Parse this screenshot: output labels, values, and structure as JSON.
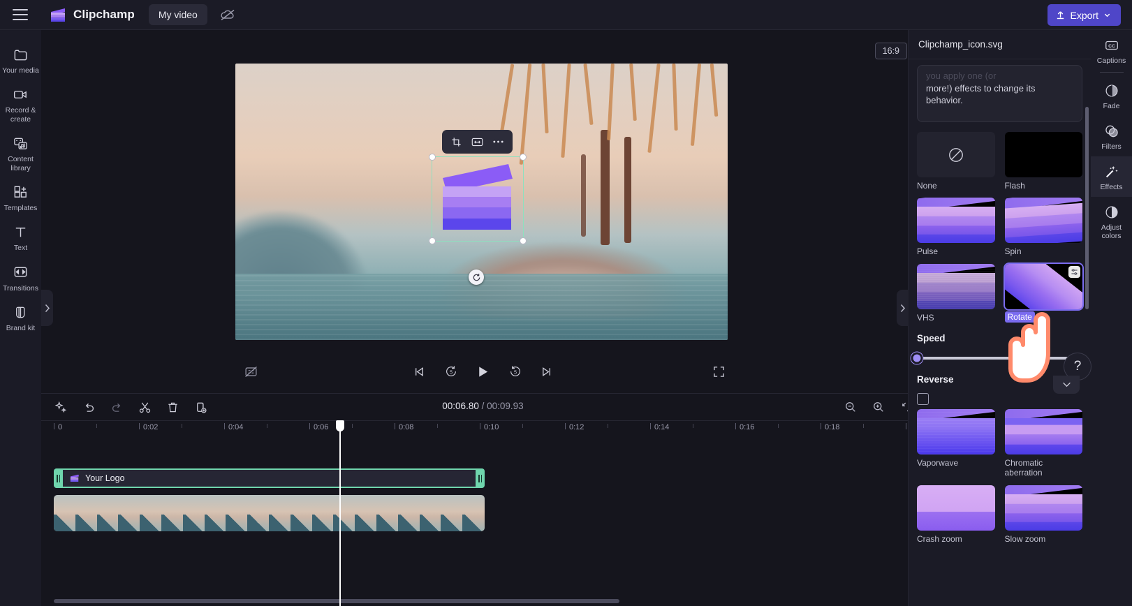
{
  "app": {
    "brand_name": "Clipchamp",
    "project_title": "My video",
    "export_label": "Export",
    "menu_icon": "hamburger-icon",
    "cloud_icon": "cloud-off-icon",
    "export_icon": "upload-icon"
  },
  "left_rail": {
    "items": [
      {
        "label": "Your media",
        "icon": "folder-icon"
      },
      {
        "label": "Record & create",
        "icon": "camera-icon"
      },
      {
        "label": "Content library",
        "icon": "library-icon"
      },
      {
        "label": "Templates",
        "icon": "templates-icon"
      },
      {
        "label": "Text",
        "icon": "text-icon"
      },
      {
        "label": "Transitions",
        "icon": "transitions-icon"
      },
      {
        "label": "Brand kit",
        "icon": "brandkit-icon"
      }
    ]
  },
  "stage": {
    "aspect_ratio": "16:9",
    "float_toolbar": [
      {
        "name": "crop",
        "icon": "crop-icon"
      },
      {
        "name": "fit-fill",
        "icon": "fit-icon"
      },
      {
        "name": "more",
        "icon": "ellipsis-icon"
      }
    ]
  },
  "playback": {
    "current_time": "00:06.80",
    "total_time": "00:09.93",
    "time_separator": "/",
    "controls": [
      {
        "name": "previous-frame",
        "icon": "skip-back-icon"
      },
      {
        "name": "back-5-seconds",
        "icon": "rewind-5-icon"
      },
      {
        "name": "play",
        "icon": "play-icon"
      },
      {
        "name": "forward-5-seconds",
        "icon": "forward-5-icon"
      },
      {
        "name": "next-frame",
        "icon": "skip-forward-icon"
      }
    ],
    "captions_toggle_icon": "captions-off-icon",
    "fullscreen_icon": "fullscreen-icon",
    "help_label": "?"
  },
  "timeline": {
    "toolbar": [
      {
        "name": "magic-tools",
        "icon": "sparkle-icon"
      },
      {
        "name": "undo",
        "icon": "undo-icon"
      },
      {
        "name": "redo",
        "icon": "redo-icon"
      },
      {
        "name": "split",
        "icon": "scissors-icon"
      },
      {
        "name": "delete",
        "icon": "trash-icon"
      },
      {
        "name": "duplicate",
        "icon": "duplicate-icon"
      }
    ],
    "right_controls": [
      {
        "name": "zoom-out",
        "icon": "zoom-out-icon"
      },
      {
        "name": "zoom-in",
        "icon": "zoom-in-icon"
      },
      {
        "name": "fit-timeline",
        "icon": "fit-timeline-icon"
      }
    ],
    "ruler_labels": [
      "0",
      "0:02",
      "0:04",
      "0:06",
      "0:08",
      "0:10",
      "0:12",
      "0:14",
      "0:16",
      "0:18"
    ],
    "clips": [
      {
        "name": "logo-clip",
        "label": "Your Logo",
        "icon": "clapperboard-icon",
        "selected": true
      },
      {
        "name": "video-clip",
        "label": "",
        "selected": false
      }
    ]
  },
  "right_panel": {
    "header_title": "Clipchamp_icon.svg",
    "tip_faded": "you apply one (or",
    "tip_text": "more!) effects to change its behavior.",
    "effects": [
      {
        "label": "None",
        "thumb": "none",
        "selected": false
      },
      {
        "label": "Flash",
        "thumb": "flash",
        "selected": false
      },
      {
        "label": "Pulse",
        "thumb": "pulse",
        "selected": false
      },
      {
        "label": "Spin",
        "thumb": "spin",
        "selected": false
      },
      {
        "label": "VHS",
        "thumb": "vhs",
        "selected": false
      },
      {
        "label": "Rotate",
        "thumb": "rotate",
        "selected": true
      },
      {
        "label": "Vaporwave",
        "thumb": "vapor",
        "selected": false
      },
      {
        "label": "Chromatic aberration",
        "thumb": "chrom",
        "selected": false
      },
      {
        "label": "Crash zoom",
        "thumb": "crash",
        "selected": false
      },
      {
        "label": "Slow zoom",
        "thumb": "slow",
        "selected": false
      }
    ],
    "speed_label": "Speed",
    "speed_value": 0,
    "reverse_label": "Reverse",
    "reverse_checked": false
  },
  "right_rail": {
    "items": [
      {
        "label": "Captions",
        "icon": "cc-icon",
        "active": false
      },
      {
        "label": "Fade",
        "icon": "fade-icon",
        "active": false
      },
      {
        "label": "Filters",
        "icon": "filters-icon",
        "active": false
      },
      {
        "label": "Effects",
        "icon": "effects-wand-icon",
        "active": true
      },
      {
        "label": "Adjust colors",
        "icon": "adjust-colors-icon",
        "active": false
      }
    ]
  },
  "colors": {
    "accent": "#4f46c8",
    "panel": "#1b1b26",
    "background": "#15151d",
    "selection": "#6fd5ad",
    "effect_selected": "#7b6cf0",
    "cursor_outline": "#ff8a6b"
  }
}
